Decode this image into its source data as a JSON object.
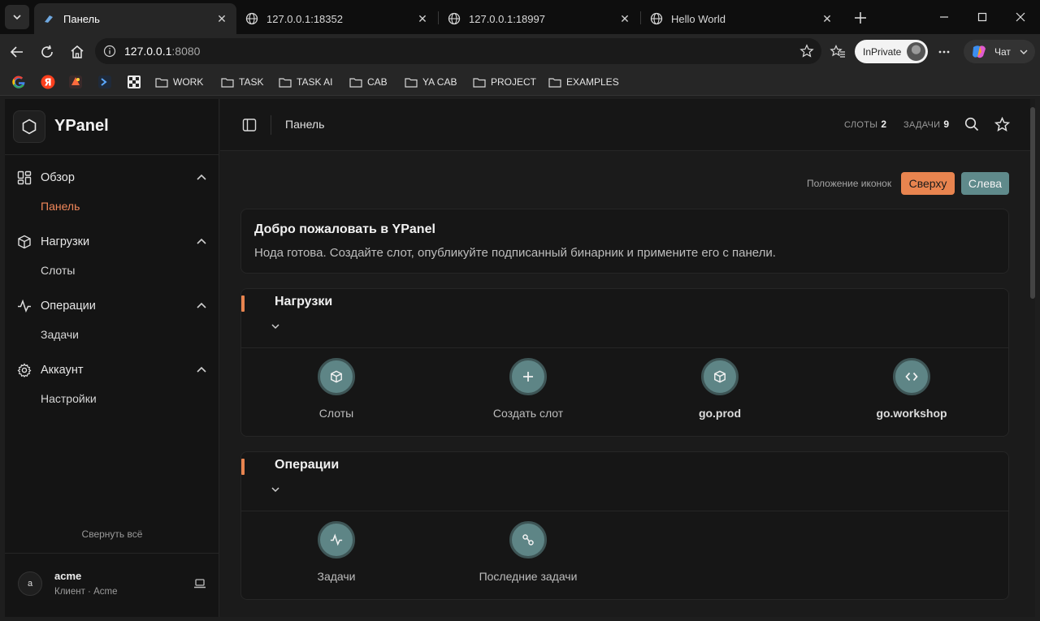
{
  "browser": {
    "tabs": [
      {
        "title": "Панель",
        "active": true
      },
      {
        "title": "127.0.0.1:18352",
        "active": false
      },
      {
        "title": "127.0.0.1:18997",
        "active": false
      },
      {
        "title": "Hello World",
        "active": false
      }
    ],
    "address": {
      "host": "127.0.0.1",
      "port": ":8080"
    },
    "inprivate_label": "InPrivate",
    "copilot_label": "Чат",
    "bookmarks": [
      "WORK",
      "TASK",
      "TASK AI",
      "CAB",
      "YA CAB",
      "PROJECT",
      "EXAMPLES"
    ]
  },
  "app": {
    "brand": "YPanel",
    "nav": [
      {
        "label": "Обзор",
        "icon": "grid-icon",
        "sub": "Панель",
        "active": true
      },
      {
        "label": "Нагрузки",
        "icon": "box-icon",
        "sub": "Слоты",
        "active": false
      },
      {
        "label": "Операции",
        "icon": "activity-icon",
        "sub": "Задачи",
        "active": false
      },
      {
        "label": "Аккаунт",
        "icon": "gear-icon",
        "sub": "Настройки",
        "active": false
      }
    ],
    "collapse_all": "Свернуть всё",
    "user": {
      "initial": "a",
      "name": "acme",
      "sub": "Клиент · Acme"
    }
  },
  "topbar": {
    "breadcrumb": "Панель",
    "slots_label": "СЛОТЫ",
    "slots_count": "2",
    "tasks_label": "ЗАДАЧИ",
    "tasks_count": "9"
  },
  "icon_position": {
    "label": "Положение иконок",
    "top": "Сверху",
    "left": "Слева"
  },
  "welcome": {
    "title": "Добро пожаловать в YPanel",
    "text": "Нода готова. Создайте слот, опубликуйте подписанный бинарник и примените его с панели."
  },
  "sections": [
    {
      "title": "Нагрузки",
      "tiles": [
        {
          "label": "Слоты",
          "icon": "box-icon"
        },
        {
          "label": "Создать слот",
          "icon": "plus-icon"
        },
        {
          "label": "go.prod",
          "icon": "box-icon"
        },
        {
          "label": "go.workshop",
          "icon": "code-icon"
        }
      ]
    },
    {
      "title": "Операции",
      "tiles": [
        {
          "label": "Задачи",
          "icon": "activity-icon"
        },
        {
          "label": "Последние задачи",
          "icon": "route-icon"
        }
      ]
    }
  ],
  "colors": {
    "accent": "#e8844f",
    "teal": "#5f8a8b",
    "active_nav": "#f0875a"
  }
}
